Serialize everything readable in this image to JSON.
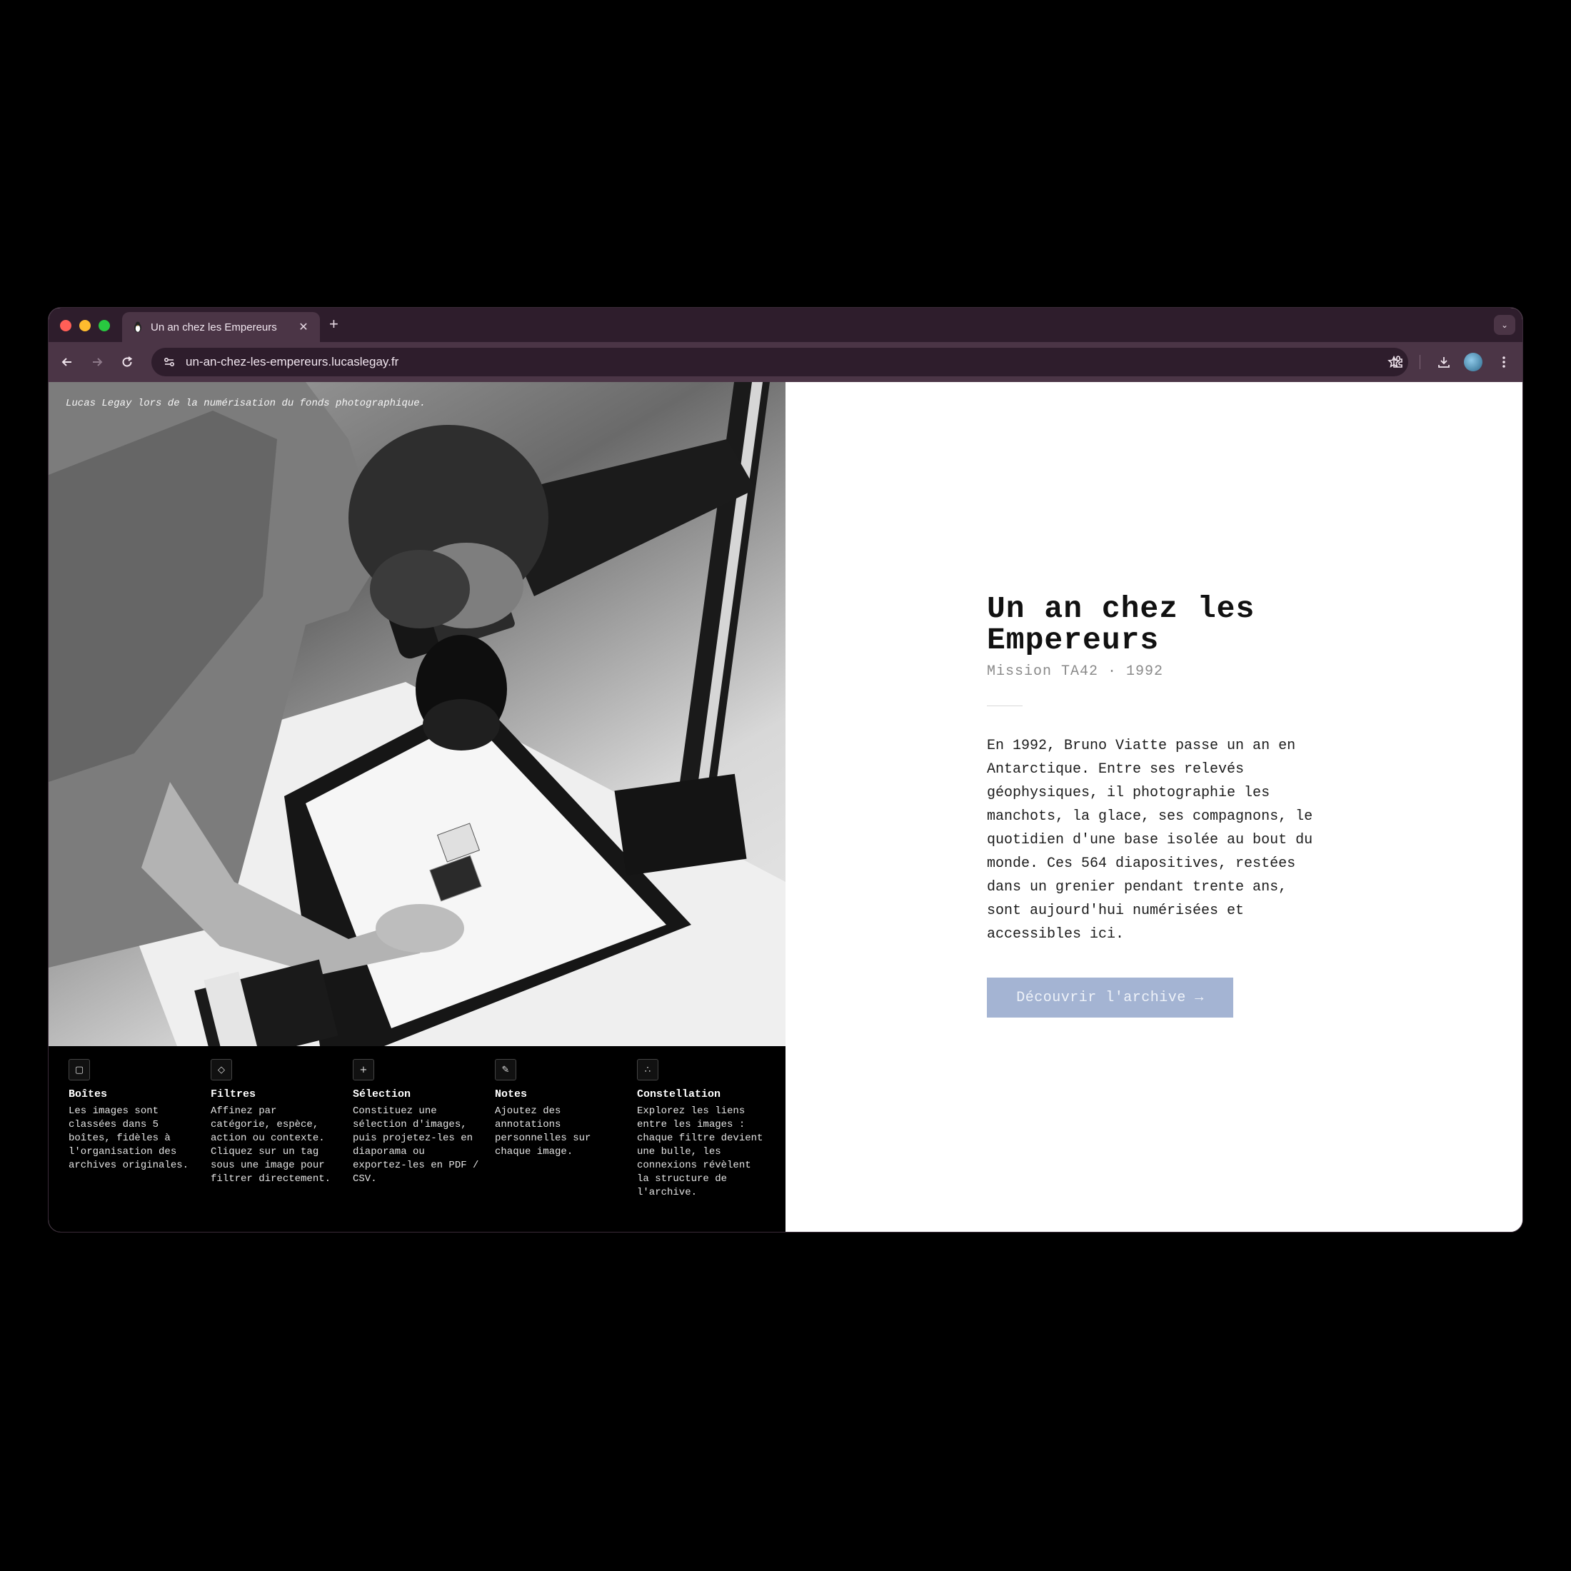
{
  "browser": {
    "tab_title": "Un an chez les Empereurs",
    "tab_favicon": "penguin-icon",
    "url": "un-an-chez-les-empereurs.lucaslegay.fr"
  },
  "photo": {
    "caption": "Lucas Legay lors de la numérisation du fonds photographique."
  },
  "features": [
    {
      "icon": "▢",
      "icon_name": "box-icon",
      "title": "Boîtes",
      "desc": "Les images sont classées dans 5 boîtes, fidèles à l'organisation des archives originales."
    },
    {
      "icon": "◇",
      "icon_name": "filter-icon",
      "title": "Filtres",
      "desc": "Affinez par catégorie, espèce, action ou contexte. Cliquez sur un tag sous une image pour filtrer directement."
    },
    {
      "icon": "+",
      "icon_name": "plus-icon",
      "title": "Sélection",
      "desc": "Constituez une sélection d'images, puis projetez-les en diaporama ou exportez-les en PDF / CSV."
    },
    {
      "icon": "✎",
      "icon_name": "pencil-icon",
      "title": "Notes",
      "desc": "Ajoutez des annotations personnelles sur chaque image."
    },
    {
      "icon": "∴",
      "icon_name": "constellation-icon",
      "title": "Constellation",
      "desc": "Explorez les liens entre les images : chaque filtre devient une bulle, les connexions révèlent la structure de l'archive."
    }
  ],
  "hero": {
    "title": "Un an chez les Empereurs",
    "subtitle": "Mission TA42 · 1992",
    "body": "En 1992, Bruno Viatte passe un an en Antarctique. Entre ses relevés géophysiques, il photographie les manchots, la glace, ses compagnons, le quotidien d'une base isolée au bout du monde. Ces 564 diapositives, restées dans un grenier pendant trente ans, sont aujourd'hui numérisées et accessibles ici.",
    "cta_label": "Découvrir l'archive →"
  },
  "colors": {
    "tabbar": "#2e1d2c",
    "toolbar": "#4b3546",
    "cta_bg": "#a4b4d3"
  }
}
